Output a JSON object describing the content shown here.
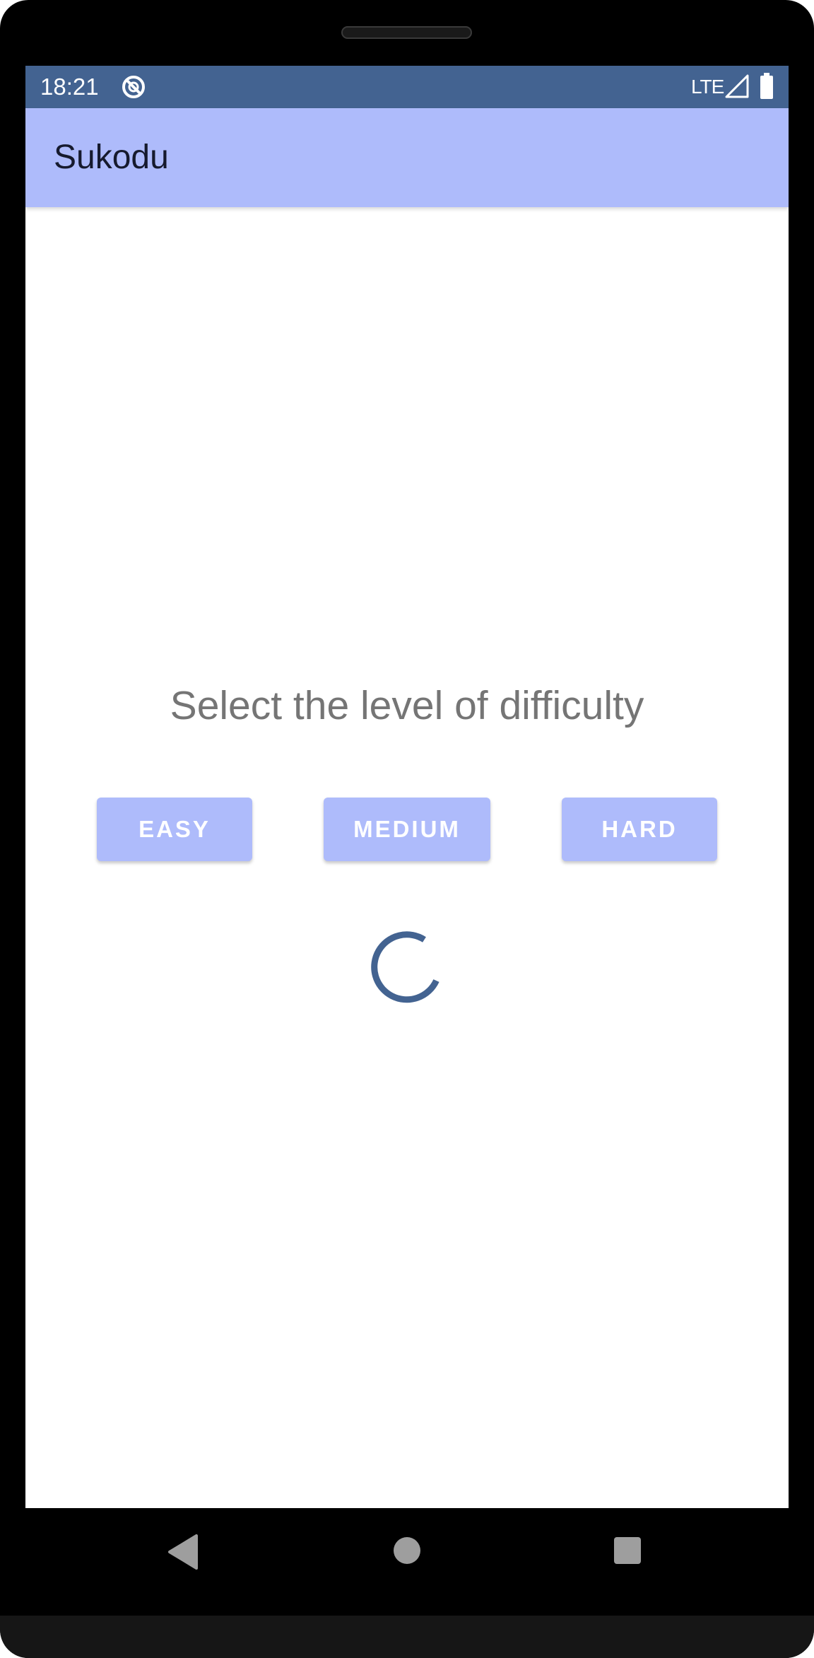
{
  "status_bar": {
    "time": "18:21",
    "network": "LTE",
    "icons": [
      "app-notification-icon",
      "signal-icon",
      "battery-icon"
    ]
  },
  "app_bar": {
    "title": "Sukodu"
  },
  "main": {
    "prompt": "Select the level of difficulty",
    "buttons": [
      {
        "label": "EASY"
      },
      {
        "label": "MEDIUM"
      },
      {
        "label": "HARD"
      }
    ],
    "loading_indicator": "progress-spinner-icon"
  },
  "nav_bar": {
    "icons": [
      "back-icon",
      "home-icon",
      "recents-icon"
    ]
  },
  "colors": {
    "status_bar": "#436391",
    "app_bar": "#aebbfb",
    "button": "#aebbfb",
    "button_text": "#ffffff",
    "prompt_text": "#757575",
    "spinner": "#436391",
    "nav_icons": "#9e9e9e"
  }
}
